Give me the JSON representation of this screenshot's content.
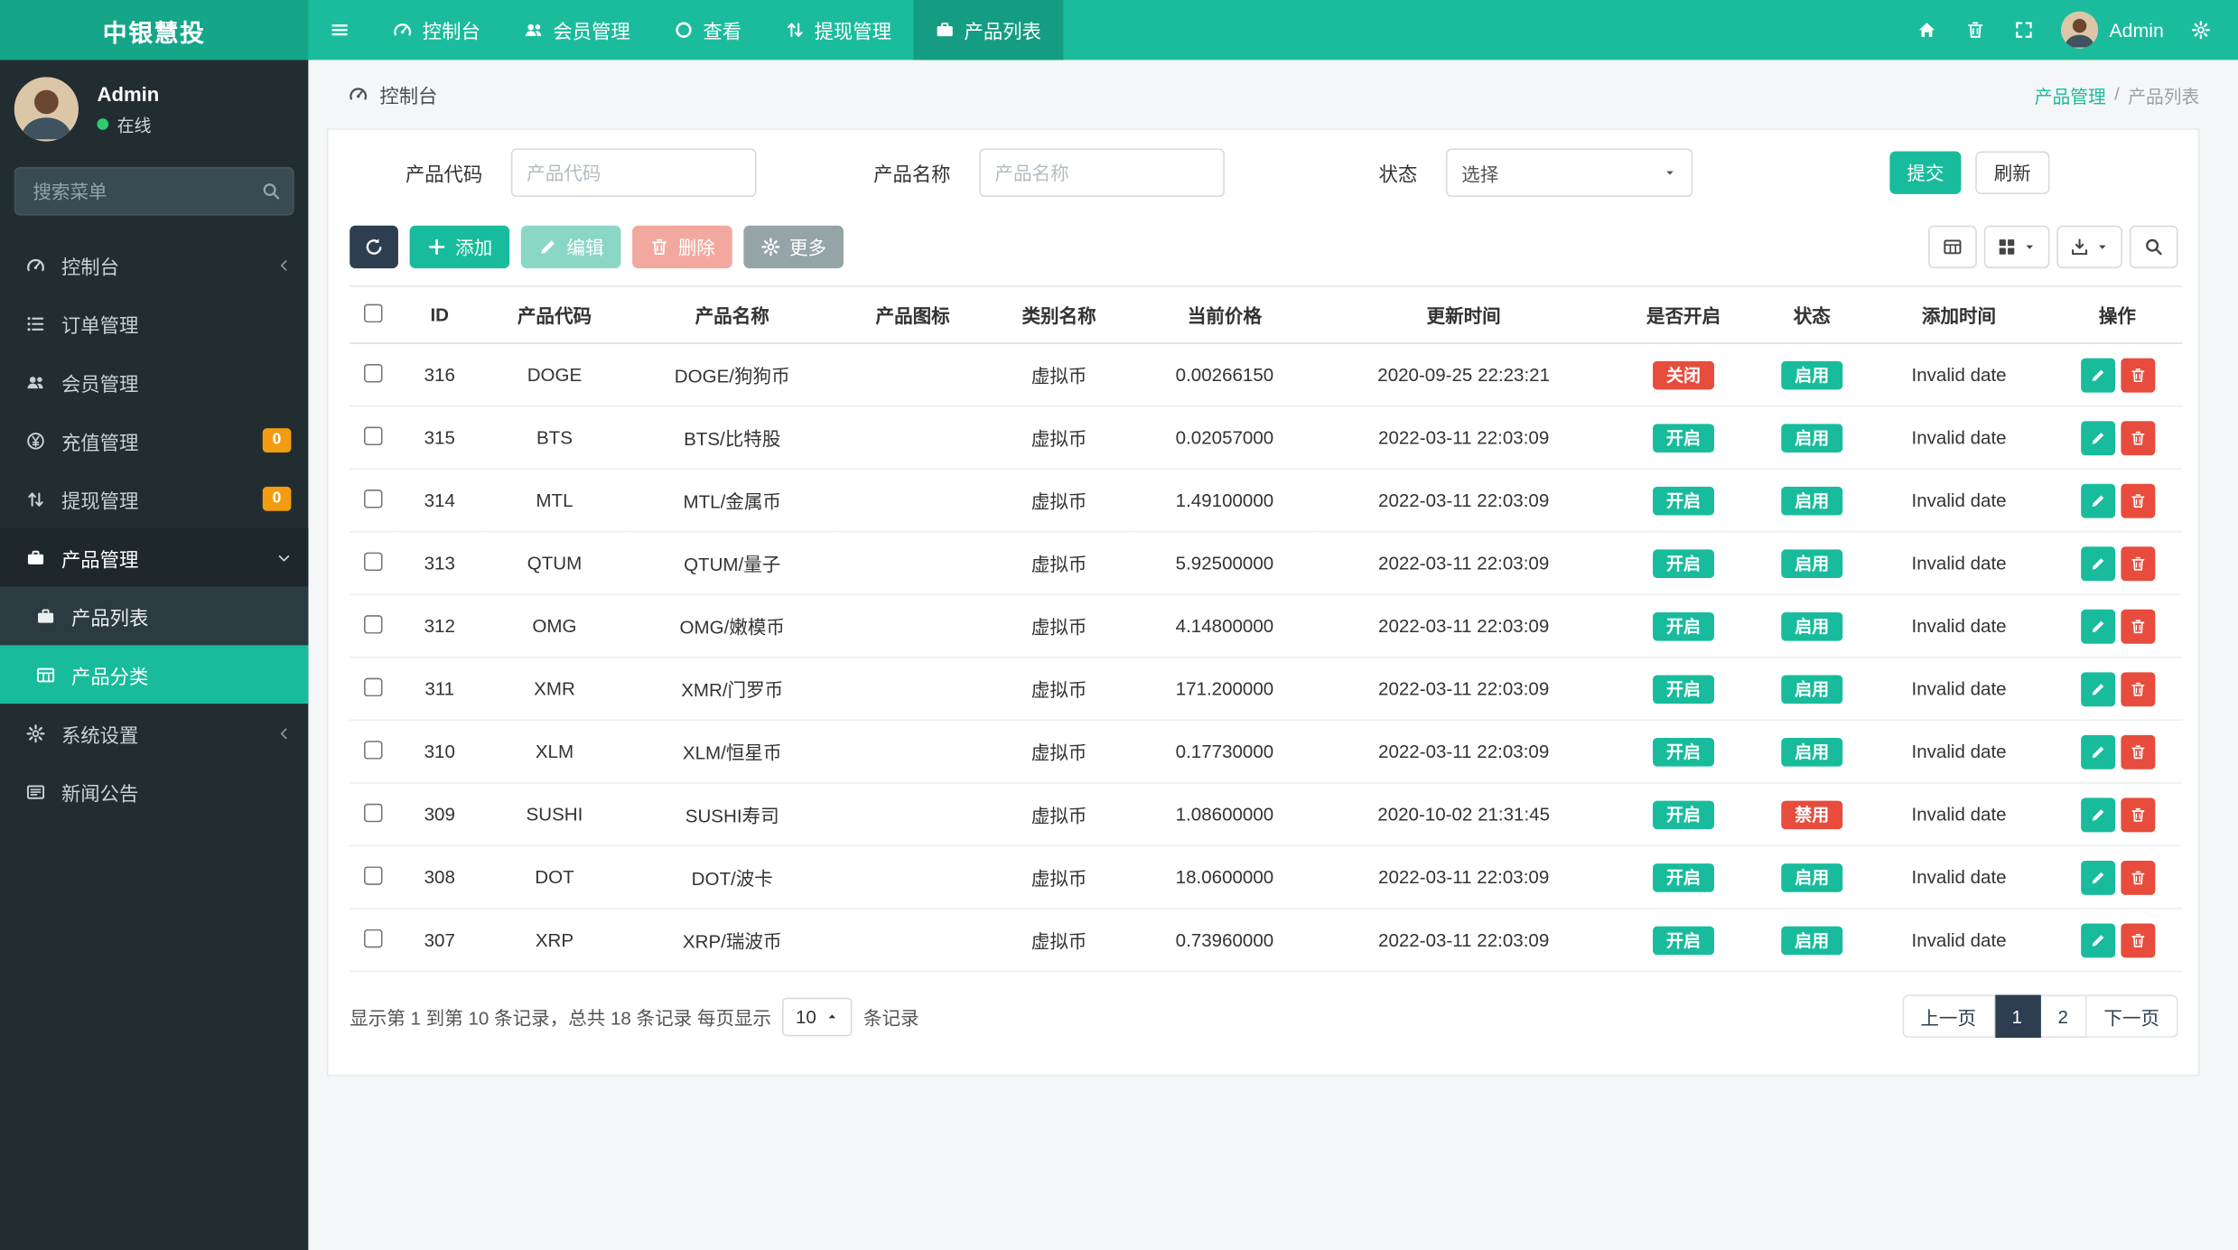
{
  "brand": {
    "title": "中银慧投"
  },
  "topnav": {
    "items": [
      {
        "key": "console",
        "label": "控制台",
        "icon": "gauge",
        "active": false
      },
      {
        "key": "members",
        "label": "会员管理",
        "icon": "users",
        "active": false
      },
      {
        "key": "view",
        "label": "查看",
        "icon": "circle",
        "active": false
      },
      {
        "key": "withdrawals",
        "label": "提现管理",
        "icon": "withdraw",
        "active": false
      },
      {
        "key": "product-list",
        "label": "产品列表",
        "icon": "briefcase",
        "active": true
      }
    ],
    "user_name": "Admin"
  },
  "sidebar": {
    "user_name": "Admin",
    "user_status": "在线",
    "search_placeholder": "搜索菜单",
    "items": [
      {
        "key": "console",
        "label": "控制台",
        "icon": "gauge",
        "chevron": "left"
      },
      {
        "key": "orders",
        "label": "订单管理",
        "icon": "list"
      },
      {
        "key": "members",
        "label": "会员管理",
        "icon": "users"
      },
      {
        "key": "recharge",
        "label": "充值管理",
        "icon": "yen",
        "badge": "0"
      },
      {
        "key": "withdrawals",
        "label": "提现管理",
        "icon": "withdraw",
        "badge": "0"
      },
      {
        "key": "products",
        "label": "产品管理",
        "icon": "briefcase",
        "chevron": "down",
        "active": true
      },
      {
        "key": "product-list",
        "label": "产品列表",
        "icon": "briefcase",
        "submenu": true
      },
      {
        "key": "product-category",
        "label": "产品分类",
        "icon": "table",
        "submenu": true,
        "highlight": true
      },
      {
        "key": "settings",
        "label": "系统设置",
        "icon": "gear",
        "chevron": "left"
      },
      {
        "key": "news",
        "label": "新闻公告",
        "icon": "news"
      }
    ]
  },
  "breadcrumb": {
    "page": "控制台",
    "section": "产品管理",
    "separator": "/",
    "current": "产品列表"
  },
  "filters": {
    "code_label": "产品代码",
    "code_placeholder": "产品代码",
    "name_label": "产品名称",
    "name_placeholder": "产品名称",
    "status_label": "状态",
    "status_value": "选择",
    "submit": "提交",
    "refresh": "刷新"
  },
  "toolbar": {
    "add": "添加",
    "edit": "编辑",
    "delete": "删除",
    "more": "更多"
  },
  "table": {
    "columns": [
      "ID",
      "产品代码",
      "产品名称",
      "产品图标",
      "类别名称",
      "当前价格",
      "更新时间",
      "是否开启",
      "状态",
      "添加时间",
      "操作"
    ],
    "rows": [
      {
        "id": "316",
        "code": "DOGE",
        "name": "DOGE/狗狗币",
        "category": "虚拟币",
        "price": "0.00266150",
        "updated": "2020-09-25 22:23:21",
        "open": "关闭",
        "open_type": "danger",
        "status": "启用",
        "status_type": "success",
        "added": "Invalid date"
      },
      {
        "id": "315",
        "code": "BTS",
        "name": "BTS/比特股",
        "category": "虚拟币",
        "price": "0.02057000",
        "updated": "2022-03-11 22:03:09",
        "open": "开启",
        "open_type": "success",
        "status": "启用",
        "status_type": "success",
        "added": "Invalid date"
      },
      {
        "id": "314",
        "code": "MTL",
        "name": "MTL/金属币",
        "category": "虚拟币",
        "price": "1.49100000",
        "updated": "2022-03-11 22:03:09",
        "open": "开启",
        "open_type": "success",
        "status": "启用",
        "status_type": "success",
        "added": "Invalid date"
      },
      {
        "id": "313",
        "code": "QTUM",
        "name": "QTUM/量子",
        "category": "虚拟币",
        "price": "5.92500000",
        "updated": "2022-03-11 22:03:09",
        "open": "开启",
        "open_type": "success",
        "status": "启用",
        "status_type": "success",
        "added": "Invalid date"
      },
      {
        "id": "312",
        "code": "OMG",
        "name": "OMG/嫩模币",
        "category": "虚拟币",
        "price": "4.14800000",
        "updated": "2022-03-11 22:03:09",
        "open": "开启",
        "open_type": "success",
        "status": "启用",
        "status_type": "success",
        "added": "Invalid date"
      },
      {
        "id": "311",
        "code": "XMR",
        "name": "XMR/门罗币",
        "category": "虚拟币",
        "price": "171.200000",
        "updated": "2022-03-11 22:03:09",
        "open": "开启",
        "open_type": "success",
        "status": "启用",
        "status_type": "success",
        "added": "Invalid date"
      },
      {
        "id": "310",
        "code": "XLM",
        "name": "XLM/恒星币",
        "category": "虚拟币",
        "price": "0.17730000",
        "updated": "2022-03-11 22:03:09",
        "open": "开启",
        "open_type": "success",
        "status": "启用",
        "status_type": "success",
        "added": "Invalid date"
      },
      {
        "id": "309",
        "code": "SUSHI",
        "name": "SUSHI寿司",
        "category": "虚拟币",
        "price": "1.08600000",
        "updated": "2020-10-02 21:31:45",
        "open": "开启",
        "open_type": "success",
        "status": "禁用",
        "status_type": "danger",
        "added": "Invalid date"
      },
      {
        "id": "308",
        "code": "DOT",
        "name": "DOT/波卡",
        "category": "虚拟币",
        "price": "18.0600000",
        "updated": "2022-03-11 22:03:09",
        "open": "开启",
        "open_type": "success",
        "status": "启用",
        "status_type": "success",
        "added": "Invalid date"
      },
      {
        "id": "307",
        "code": "XRP",
        "name": "XRP/瑞波币",
        "category": "虚拟币",
        "price": "0.73960000",
        "updated": "2022-03-11 22:03:09",
        "open": "开启",
        "open_type": "success",
        "status": "启用",
        "status_type": "success",
        "added": "Invalid date"
      }
    ]
  },
  "footer": {
    "summary_prefix": "显示第 1 到第 10 条记录，总共 18 条记录 每页显示",
    "page_size": "10",
    "summary_suffix": "条记录",
    "pagination": {
      "prev": "上一页",
      "pages": [
        {
          "label": "1",
          "active": true
        },
        {
          "label": "2",
          "active": false
        }
      ],
      "next": "下一页"
    }
  }
}
